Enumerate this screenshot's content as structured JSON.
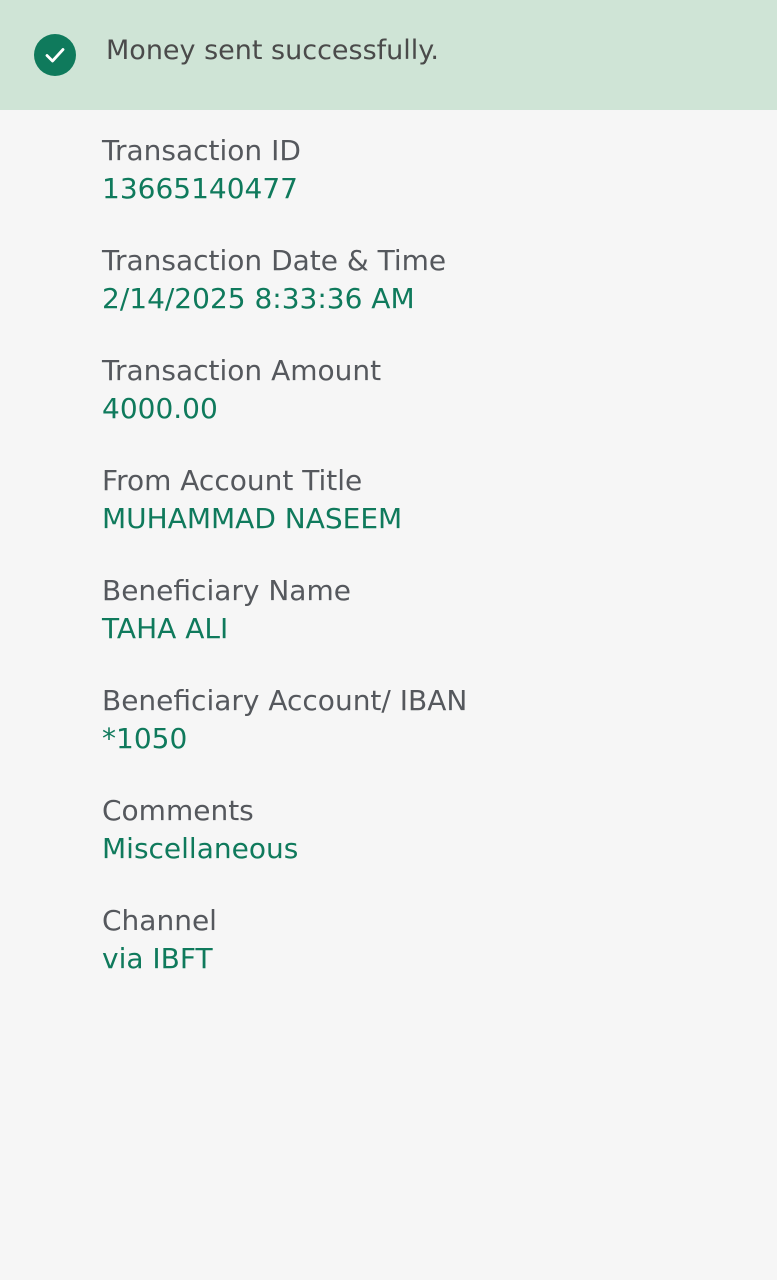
{
  "banner": {
    "icon": "check-circle-icon",
    "message": "Money sent successfully."
  },
  "colors": {
    "banner_bg": "#cfe4d6",
    "accent": "#0f7a5c",
    "label_text": "#55585d",
    "page_bg": "#f6f6f6"
  },
  "details": [
    {
      "label": "Transaction ID",
      "value": "13665140477"
    },
    {
      "label": "Transaction Date & Time",
      "value": "2/14/2025 8:33:36 AM"
    },
    {
      "label": "Transaction Amount",
      "value": "4000.00"
    },
    {
      "label": "From Account Title",
      "value": "MUHAMMAD NASEEM"
    },
    {
      "label": "Beneficiary Name",
      "value": "TAHA ALI"
    },
    {
      "label": "Beneficiary Account/ IBAN",
      "value": "*1050"
    },
    {
      "label": "Comments",
      "value": "Miscellaneous"
    },
    {
      "label": "Channel",
      "value": "via IBFT"
    }
  ]
}
